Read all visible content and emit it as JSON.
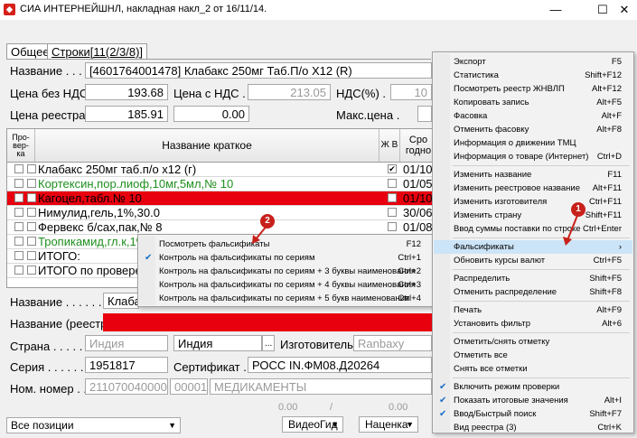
{
  "window": {
    "title": "СИА ИНТЕРНЕЙШНЛ, накладная накл_2 от 16/11/14.",
    "minimize": "—",
    "maximize": "☐",
    "close": "✕"
  },
  "tabs": [
    "Общее",
    "Строки[11(2/3/8)]"
  ],
  "top": {
    "name_label": "Название . . . . .",
    "name_value": "[4601764001478] Клабакс 250мг Таб.П/о X12 (R)",
    "price_no_vat_label": "Цена без НДС .",
    "price_no_vat": "193.68",
    "price_vat_label": "Цена с НДС .",
    "price_vat": "213.05",
    "vat_label": "НДС(%) .",
    "vat_value": "10",
    "registry_price_label": "Цена реестра .",
    "registry_price": "185.91",
    "field_zero": "0.00",
    "max_price_label": "Макс.цена ."
  },
  "grid": {
    "col_check": "Про-\nвер-\nка",
    "col_name": "Название краткое",
    "col_jv": "Ж В",
    "col_date": "Сро годно",
    "rows": [
      {
        "name": "Клабакс 250мг таб.п/о х12 (г)",
        "date": "01/10/2",
        "style": "normal",
        "jv": "✔"
      },
      {
        "name": "Кортексин,пор.лиоф,10мг,5мл,№ 10",
        "date": "01/05/2",
        "style": "green",
        "jv": ""
      },
      {
        "name": "Кагоцел,табл.№ 10",
        "date": "01/10/2",
        "style": "red",
        "jv": ""
      },
      {
        "name": "Нимулид,гель,1%,30.0",
        "date": "30/06/2",
        "style": "normal",
        "jv": ""
      },
      {
        "name": "Фервекс б/сах,пак,№ 8",
        "date": "01/08/2",
        "style": "normal",
        "jv": ""
      },
      {
        "name": "Тропикамид,гл.к,1%,",
        "date": "",
        "style": "green",
        "jv": ""
      },
      {
        "name": "ИТОГО:",
        "date": "",
        "style": "normal",
        "jv": ""
      },
      {
        "name": "ИТОГО по проверенн",
        "date": "",
        "style": "normal",
        "jv": ""
      }
    ]
  },
  "bottom": {
    "name_label": "Название . . . . . . .",
    "name_value": "Клаба",
    "registry_name_label": "Название (реестр) .",
    "country_label": "Страна . . . . . . . . .",
    "country_value": "Индия",
    "country_value2": "Индия",
    "ellipsis": "...",
    "maker_label": "Изготовитель . .",
    "maker_value": "Ranbaxy",
    "series_label": "Серия . . . . . . . . . .",
    "series_value": "1951817",
    "cert_label": "Сертификат . .",
    "cert_value": "РОСС IN.ФМ08.Д20264",
    "nom_label": "Ном. номер . . . . .",
    "nom_value": "2110700400000",
    "nom_code": "00001",
    "nom_group": "МЕДИКАМЕНТЫ",
    "totals_1": "0.00",
    "totals_2": "0.00",
    "slash": "/",
    "filter_value": "Все позиции",
    "video_btn": "ВидеоГид",
    "markup_btn": "Наценка"
  },
  "context_menu": {
    "items": [
      {
        "label": "Экспорт",
        "key": "F5"
      },
      {
        "label": "Статистика",
        "key": "Shift+F12"
      },
      {
        "label": "Посмотреть реестр ЖНВЛП",
        "key": "Alt+F12"
      },
      {
        "label": "Копировать запись",
        "key": "Alt+F5"
      },
      {
        "label": "Фасовка",
        "key": "Alt+F"
      },
      {
        "label": "Отменить фасовку",
        "key": "Alt+F8"
      },
      {
        "label": "Информация о движении ТМЦ",
        "key": ""
      },
      {
        "label": "Информация о товаре (Интернет)",
        "key": "Ctrl+D"
      },
      {
        "label": "Изменить название",
        "key": "F11"
      },
      {
        "label": "Изменить реестровое название",
        "key": "Alt+F11"
      },
      {
        "label": "Изменить изготовителя",
        "key": "Ctrl+F11"
      },
      {
        "label": "Изменить страну",
        "key": "Shift+F11"
      },
      {
        "label": "Ввод суммы поставки по строке",
        "key": "Ctrl+Enter"
      },
      {
        "label": "Фальсификаты",
        "key": "›"
      },
      {
        "label": "Обновить курсы валют",
        "key": "Ctrl+F5"
      },
      {
        "label": "Распределить",
        "key": "Shift+F5"
      },
      {
        "label": "Отменить распределение",
        "key": "Shift+F8"
      },
      {
        "label": "Печать",
        "key": "Alt+F9"
      },
      {
        "label": "Установить фильтр",
        "key": "Alt+6"
      },
      {
        "label": "Отметить/снять отметку",
        "key": ""
      },
      {
        "label": "Отметить все",
        "key": ""
      },
      {
        "label": "Снять все отметки",
        "key": ""
      },
      {
        "label": "Включить режим проверки",
        "key": ""
      },
      {
        "label": "Показать итоговые значения",
        "key": "Alt+I"
      },
      {
        "label": "Ввод/Быстрый поиск",
        "key": "Shift+F7"
      },
      {
        "label": "Вид реестра (3)",
        "key": "Ctrl+K"
      }
    ]
  },
  "submenu": {
    "items": [
      {
        "label": "Посмотреть фальсификаты",
        "key": "F12"
      },
      {
        "label": "Контроль на фальсификаты по сериям",
        "key": "Ctrl+1"
      },
      {
        "label": "Контроль на фальсификаты по сериям + 3 буквы наименования",
        "key": "Ctrl+2"
      },
      {
        "label": "Контроль на фальсификаты по сериям + 4 буквы наименования",
        "key": "Ctrl+3"
      },
      {
        "label": "Контроль на фальсификаты по сериям + 5 букв наименования",
        "key": "Ctrl+4"
      }
    ]
  },
  "callouts": {
    "one": "1",
    "two": "2"
  },
  "colors": {
    "highlight_row": "#e8000f",
    "menu_highlight": "#cce4f7",
    "callout": "#c8201a"
  }
}
